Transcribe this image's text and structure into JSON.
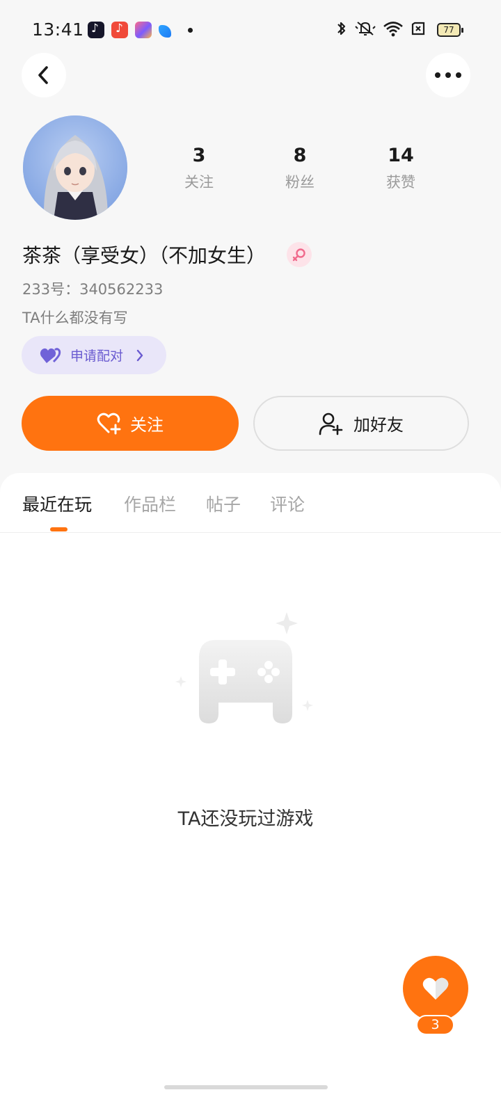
{
  "status_bar": {
    "time": "13:41",
    "battery": "77"
  },
  "profile": {
    "stats": [
      {
        "value": "3",
        "label": "关注"
      },
      {
        "value": "8",
        "label": "粉丝"
      },
      {
        "value": "14",
        "label": "获赞"
      }
    ],
    "nickname": "茶茶（享受女）（不加女生）",
    "user_id": "233号：340562233",
    "bio": "TA什么都没有写",
    "match_label": "申请配对"
  },
  "actions": {
    "follow_label": "关注",
    "add_friend_label": "加好友"
  },
  "tabs": [
    {
      "label": "最近在玩",
      "active": true
    },
    {
      "label": "作品栏",
      "active": false
    },
    {
      "label": "帖子",
      "active": false
    },
    {
      "label": "评论",
      "active": false
    }
  ],
  "empty_state": {
    "message": "TA还没玩过游戏"
  },
  "fab": {
    "count": "3"
  },
  "colors": {
    "accent": "#ff7310",
    "match": "#6a5bd0",
    "match_bg": "#e9e6f9"
  },
  "icons": [
    "back-icon",
    "more-icon",
    "female-icon",
    "heart-icon",
    "heart-plus-icon",
    "add-user-icon",
    "gamepad-icon",
    "like-icon"
  ]
}
